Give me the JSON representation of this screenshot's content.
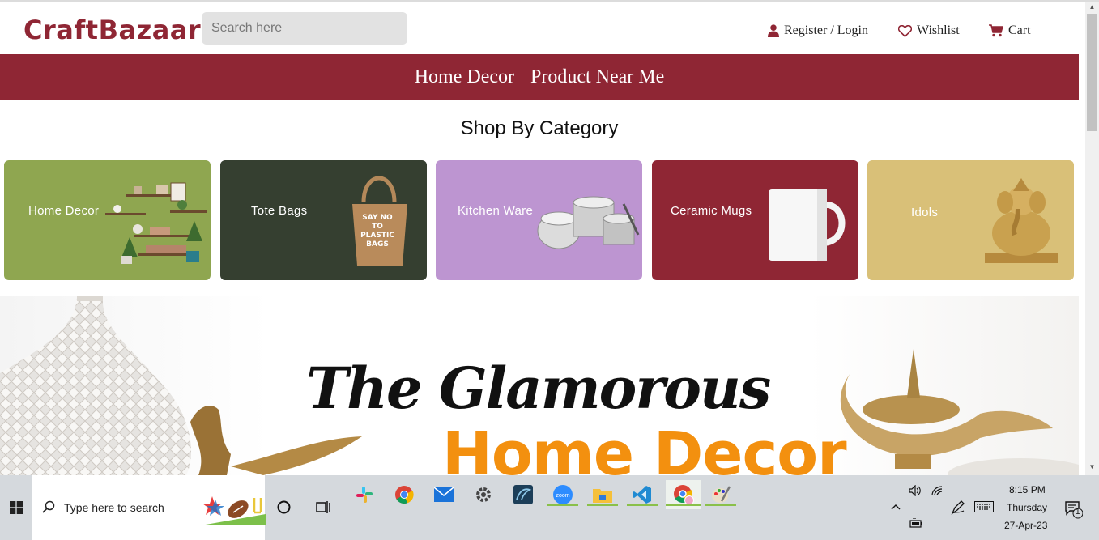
{
  "header": {
    "logo": "CraftBazaar",
    "search_placeholder": "Search here",
    "register_login": "Register / Login",
    "wishlist": "Wishlist",
    "cart": "Cart"
  },
  "nav": {
    "items": [
      "Home Decor",
      "Product Near Me"
    ]
  },
  "category_section": {
    "title": "Shop By Category",
    "cards": [
      {
        "label": "Home Decor",
        "color": "#8fa650"
      },
      {
        "label": "Tote Bags",
        "color": "#353f30"
      },
      {
        "label": "Kitchen Ware",
        "color": "#bd95d1"
      },
      {
        "label": "Ceramic Mugs",
        "color": "#8f2634"
      },
      {
        "label": "Idols",
        "color": "#d9c078"
      }
    ]
  },
  "banner": {
    "title": "The Glamorous",
    "subtitle": "Home Decor",
    "tote_text": "SAY NO TO PLASTIC BAGS"
  },
  "taskbar": {
    "search_placeholder": "Type here to search",
    "time": "8:15 PM",
    "day": "Thursday",
    "date": "27-Apr-23",
    "notification_count": "1",
    "zoom_label": "zoom"
  },
  "colors": {
    "brand": "#8f2634",
    "banner_accent": "#f3900f"
  }
}
